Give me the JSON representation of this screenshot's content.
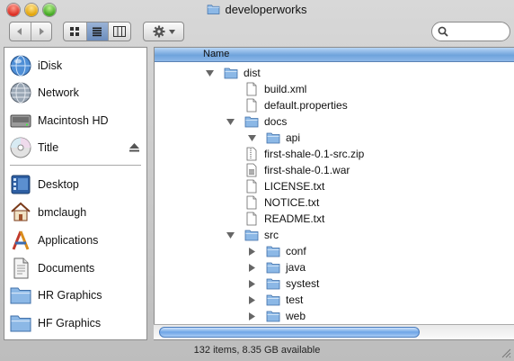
{
  "window": {
    "title": "developerworks"
  },
  "sidebar": {
    "devices": [
      {
        "label": "iDisk",
        "icon": "idisk-globe-icon"
      },
      {
        "label": "Network",
        "icon": "network-globe-icon"
      },
      {
        "label": "Macintosh HD",
        "icon": "hard-drive-icon"
      },
      {
        "label": "Title",
        "icon": "cd-disc-icon"
      }
    ],
    "places": [
      {
        "label": "Desktop",
        "icon": "desktop-icon"
      },
      {
        "label": "bmclaugh",
        "icon": "home-icon"
      },
      {
        "label": "Applications",
        "icon": "applications-icon"
      },
      {
        "label": "Documents",
        "icon": "documents-icon"
      },
      {
        "label": "HR Graphics",
        "icon": "folder-icon"
      },
      {
        "label": "HF Graphics",
        "icon": "folder-icon"
      }
    ]
  },
  "list": {
    "header": "Name",
    "rows": [
      {
        "name": "dist",
        "kind": "folder",
        "level": 0,
        "expanded": true
      },
      {
        "name": "build.xml",
        "kind": "file",
        "level": 1
      },
      {
        "name": "default.properties",
        "kind": "file",
        "level": 1
      },
      {
        "name": "docs",
        "kind": "folder",
        "level": 1,
        "expanded": true
      },
      {
        "name": "api",
        "kind": "folder",
        "level": 2,
        "expanded": true
      },
      {
        "name": "first-shale-0.1-src.zip",
        "kind": "zip",
        "level": 1
      },
      {
        "name": "first-shale-0.1.war",
        "kind": "war",
        "level": 1
      },
      {
        "name": "LICENSE.txt",
        "kind": "file",
        "level": 1
      },
      {
        "name": "NOTICE.txt",
        "kind": "file",
        "level": 1
      },
      {
        "name": "README.txt",
        "kind": "file",
        "level": 1
      },
      {
        "name": "src",
        "kind": "folder",
        "level": 1,
        "expanded": true
      },
      {
        "name": "conf",
        "kind": "folder",
        "level": 2,
        "expanded": false
      },
      {
        "name": "java",
        "kind": "folder",
        "level": 2,
        "expanded": false
      },
      {
        "name": "systest",
        "kind": "folder",
        "level": 2,
        "expanded": false
      },
      {
        "name": "test",
        "kind": "folder",
        "level": 2,
        "expanded": false
      },
      {
        "name": "web",
        "kind": "folder",
        "level": 2,
        "expanded": false
      }
    ]
  },
  "status": {
    "text": "132 items, 8.35 GB available"
  },
  "search": {
    "placeholder": "",
    "value": ""
  },
  "colors": {
    "accent": "#6fa3dc",
    "folder": "#8cb8e6"
  }
}
